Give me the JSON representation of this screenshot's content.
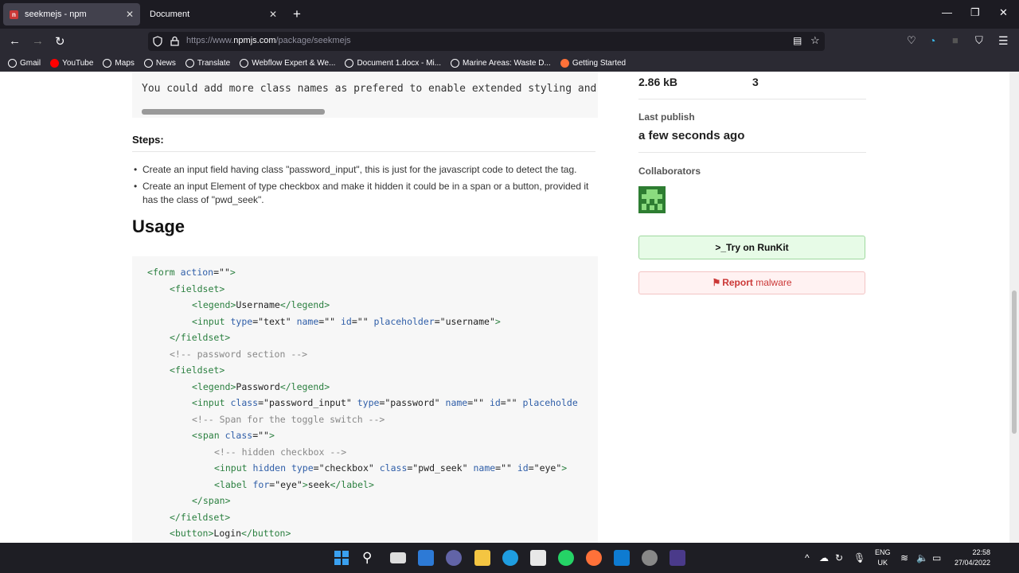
{
  "browser": {
    "tabs": [
      {
        "label": "seekmejs - npm",
        "active": true
      },
      {
        "label": "Document",
        "active": false
      }
    ],
    "url_prefix": "https://www.",
    "url_domain": "npmjs.com",
    "url_path": "/package/seekmejs",
    "bookmarks": [
      "Gmail",
      "YouTube",
      "Maps",
      "News",
      "Translate",
      "Webflow Expert & We...",
      "Document 1.docx - Mi...",
      "Marine Areas: Waste D...",
      "Getting Started"
    ]
  },
  "readme": {
    "pre_top_line": "You could add more class names as prefered to enable extended styling and m",
    "steps_heading": "Steps:",
    "steps": [
      "Create an input field having class \"password_input\", this is just for the javascript code to detect the tag.",
      "Create an input Element of type checkbox and make it hidden it could be in a span or a button, provided it has the class of \"pwd_seek\"."
    ],
    "usage_heading": "Usage"
  },
  "code_lines": [
    [
      [
        "tg",
        "<"
      ],
      [
        "tg",
        "form"
      ],
      [
        "at",
        " action"
      ],
      [
        "st",
        "=\"\""
      ],
      [
        "tg",
        ">"
      ]
    ],
    [
      [
        "tg",
        "<"
      ],
      [
        "tg",
        "fieldset"
      ],
      [
        "tg",
        ">"
      ]
    ],
    [
      [
        "tg",
        "<"
      ],
      [
        "tg",
        "legend"
      ],
      [
        "tg",
        ">"
      ],
      [
        "st",
        "Username"
      ],
      [
        "tg",
        "</"
      ],
      [
        "tg",
        "legend"
      ],
      [
        "tg",
        ">"
      ]
    ],
    [
      [
        "tg",
        "<"
      ],
      [
        "tg",
        "input"
      ],
      [
        "at",
        " type"
      ],
      [
        "st",
        "=\"text\""
      ],
      [
        "at",
        " name"
      ],
      [
        "st",
        "=\"\""
      ],
      [
        "at",
        " id"
      ],
      [
        "st",
        "=\"\""
      ],
      [
        "at",
        " placeholder"
      ],
      [
        "st",
        "=\"username\""
      ],
      [
        "tg",
        ">"
      ]
    ],
    [
      [
        "tg",
        "</"
      ],
      [
        "tg",
        "fieldset"
      ],
      [
        "tg",
        ">"
      ]
    ],
    [
      [
        "cm",
        "<!-- password section -->"
      ]
    ],
    [
      [
        "tg",
        "<"
      ],
      [
        "tg",
        "fieldset"
      ],
      [
        "tg",
        ">"
      ]
    ],
    [
      [
        "tg",
        "<"
      ],
      [
        "tg",
        "legend"
      ],
      [
        "tg",
        ">"
      ],
      [
        "st",
        "Password"
      ],
      [
        "tg",
        "</"
      ],
      [
        "tg",
        "legend"
      ],
      [
        "tg",
        ">"
      ]
    ],
    [
      [
        "tg",
        "<"
      ],
      [
        "tg",
        "input"
      ],
      [
        "at",
        " class"
      ],
      [
        "st",
        "=\"password_input\""
      ],
      [
        "at",
        " type"
      ],
      [
        "st",
        "=\"password\""
      ],
      [
        "at",
        " name"
      ],
      [
        "st",
        "=\"\""
      ],
      [
        "at",
        " id"
      ],
      [
        "st",
        "=\"\""
      ],
      [
        "at",
        " placeholde"
      ]
    ],
    [
      [
        "cm",
        "<!-- Span for the toggle switch -->"
      ]
    ],
    [
      [
        "tg",
        "<"
      ],
      [
        "tg",
        "span"
      ],
      [
        "at",
        " class"
      ],
      [
        "st",
        "=\"\""
      ],
      [
        "tg",
        ">"
      ]
    ],
    [
      [
        "cm",
        "<!-- hidden checkbox -->"
      ]
    ],
    [
      [
        "tg",
        "<"
      ],
      [
        "tg",
        "input"
      ],
      [
        "at",
        " hidden"
      ],
      [
        "at",
        " type"
      ],
      [
        "st",
        "=\"checkbox\""
      ],
      [
        "at",
        " class"
      ],
      [
        "st",
        "=\"pwd_seek\""
      ],
      [
        "at",
        " name"
      ],
      [
        "st",
        "=\"\""
      ],
      [
        "at",
        " id"
      ],
      [
        "st",
        "=\"eye\""
      ],
      [
        "tg",
        ">"
      ]
    ],
    [
      [
        "tg",
        "<"
      ],
      [
        "tg",
        "label"
      ],
      [
        "at",
        " for"
      ],
      [
        "st",
        "=\"eye\""
      ],
      [
        "tg",
        ">"
      ],
      [
        "st",
        "seek"
      ],
      [
        "tg",
        "</"
      ],
      [
        "tg",
        "label"
      ],
      [
        "tg",
        ">"
      ]
    ],
    [
      [
        "tg",
        "</"
      ],
      [
        "tg",
        "span"
      ],
      [
        "tg",
        ">"
      ]
    ],
    [
      [
        "tg",
        "</"
      ],
      [
        "tg",
        "fieldset"
      ],
      [
        "tg",
        ">"
      ]
    ],
    [
      [
        "tg",
        "<"
      ],
      [
        "tg",
        "button"
      ],
      [
        "tg",
        ">"
      ],
      [
        "st",
        "Login"
      ],
      [
        "tg",
        "</"
      ],
      [
        "tg",
        "button"
      ],
      [
        "tg",
        ">"
      ]
    ]
  ],
  "sidebar": {
    "unpacked_size": "2.86 kB",
    "total_files": "3",
    "last_publish_label": "Last publish",
    "last_publish_value": "a few seconds ago",
    "collaborators_label": "Collaborators",
    "runkit_button": "Try on RunKit",
    "runkit_prefix": ">_",
    "report_button": "Report",
    "report_suffix": " malware"
  },
  "taskbar": {
    "lang_line1": "ENG",
    "lang_line2": "UK",
    "time": "22:58",
    "date": "27/04/2022"
  }
}
